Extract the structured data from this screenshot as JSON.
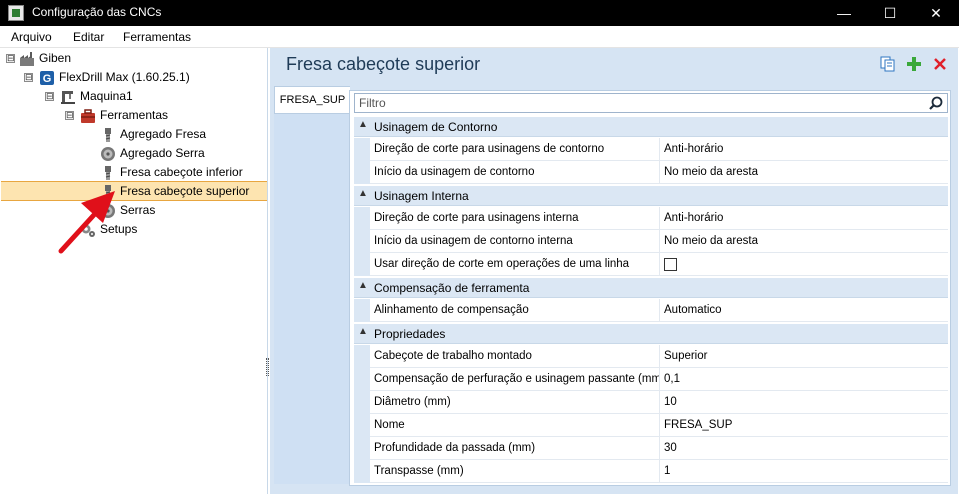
{
  "window": {
    "title": "Configuração das CNCs",
    "controls": {
      "minimize": "—",
      "maximize": "☐",
      "close": "✕"
    }
  },
  "menu": [
    "Arquivo",
    "Editar",
    "Ferramentas"
  ],
  "tree": {
    "items": [
      {
        "label": "Giben",
        "icon": "factory-icon",
        "expander": "⊟"
      },
      {
        "label": "FlexDrill Max (1.60.25.1)",
        "icon": "machine-logo-icon",
        "expander": "⊟"
      },
      {
        "label": "Maquina1",
        "icon": "cnc-machine-icon",
        "expander": "⊟"
      },
      {
        "label": "Ferramentas",
        "icon": "toolbox-icon",
        "expander": "⊟"
      },
      {
        "label": "Agregado Fresa",
        "icon": "mill-tool-icon"
      },
      {
        "label": "Agregado Serra",
        "icon": "saw-blade-icon"
      },
      {
        "label": "Fresa cabeçote inferior",
        "icon": "mill-tool-icon"
      },
      {
        "label": "Fresa cabeçote superior",
        "icon": "mill-tool-icon",
        "selected": true
      },
      {
        "label": "Serras",
        "icon": "saw-blade-icon"
      },
      {
        "label": "Setups",
        "icon": "gears-icon"
      }
    ]
  },
  "panel": {
    "title": "Fresa cabeçote superior",
    "tab": "FRESA_SUP",
    "filter_placeholder": "Filtro",
    "colors": {
      "accent": "#d6e4f3",
      "selection": "#fde4b0",
      "arrow": "#e0101a"
    },
    "categories": [
      {
        "label": "Usinagem de Contorno",
        "props": [
          {
            "name": "Direção de corte para usinagens de contorno",
            "value": "Anti-horário"
          },
          {
            "name": "Início da usinagem de contorno",
            "value": "No meio da aresta"
          }
        ]
      },
      {
        "label": "Usinagem Interna",
        "props": [
          {
            "name": "Direção de corte para usinagens interna",
            "value": "Anti-horário"
          },
          {
            "name": "Início da usinagem de contorno interna",
            "value": "No meio da aresta"
          },
          {
            "name": "Usar direção de corte em operações de uma linha",
            "value": "",
            "checkbox": false
          }
        ]
      },
      {
        "label": "Compensação de ferramenta",
        "props": [
          {
            "name": "Alinhamento de compensação",
            "value": "Automatico"
          }
        ]
      },
      {
        "label": "Propriedades",
        "props": [
          {
            "name": "Cabeçote de trabalho montado",
            "value": "Superior"
          },
          {
            "name": "Compensação de perfuração e usinagem passante (mm)",
            "value": "0,1"
          },
          {
            "name": "Diâmetro (mm)",
            "value": "10"
          },
          {
            "name": "Nome",
            "value": "FRESA_SUP"
          },
          {
            "name": "Profundidade da passada (mm)",
            "value": "30"
          },
          {
            "name": "Transpasse (mm)",
            "value": "1"
          }
        ]
      }
    ]
  }
}
